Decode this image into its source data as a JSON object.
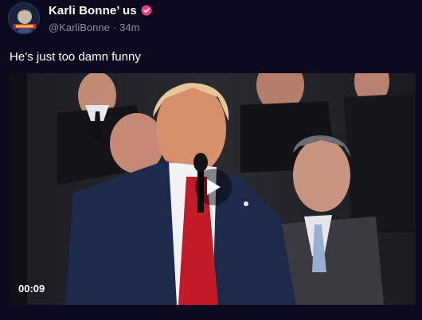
{
  "post": {
    "author": {
      "display_name": "Karli Bonne’ us",
      "handle": "@KarliBonne",
      "separator": "·",
      "time_ago": "34m",
      "verified_color": "#e8407a"
    },
    "text": "He’s just too damn funny",
    "video": {
      "duration": "00:09",
      "play_icon": "play-icon"
    }
  },
  "colors": {
    "background": "#0c0a1f",
    "secondary_text": "#8e8aa8"
  }
}
